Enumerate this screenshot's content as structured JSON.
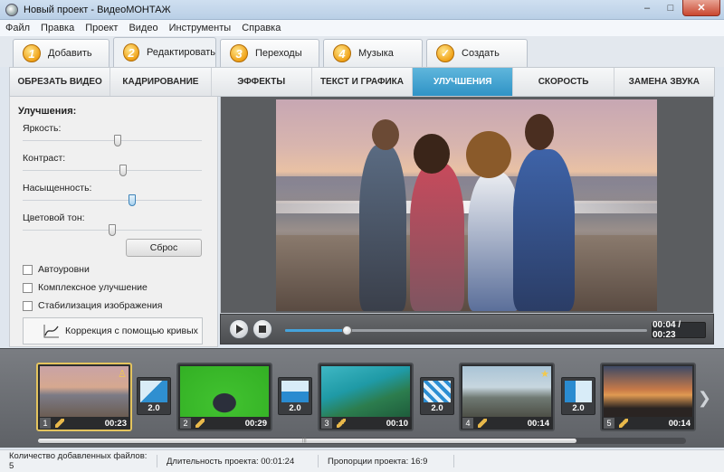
{
  "window": {
    "title": "Новый проект - ВидеоМОНТАЖ",
    "close_label": "✕",
    "min_label": "–",
    "max_label": "□"
  },
  "menu": [
    "Файл",
    "Правка",
    "Проект",
    "Видео",
    "Инструменты",
    "Справка"
  ],
  "steps": [
    {
      "num": "1",
      "label": "Добавить"
    },
    {
      "num": "2",
      "label": "Редактировать"
    },
    {
      "num": "3",
      "label": "Переходы"
    },
    {
      "num": "4",
      "label": "Музыка"
    },
    {
      "num": "✓",
      "label": "Создать"
    }
  ],
  "active_step": 1,
  "subtabs": [
    "ОБРЕЗАТЬ ВИДЕО",
    "КАДРИРОВАНИЕ",
    "ЭФФЕКТЫ",
    "ТЕКСТ И ГРАФИКА",
    "УЛУЧШЕНИЯ",
    "СКОРОСТЬ",
    "ЗАМЕНА ЗВУКА"
  ],
  "active_subtab": 4,
  "enhance": {
    "title": "Улучшения:",
    "sliders": [
      {
        "label": "Яркость:",
        "value": 0.53
      },
      {
        "label": "Контраст:",
        "value": 0.56
      },
      {
        "label": "Насыщенность:",
        "value": 0.61
      },
      {
        "label": "Цветовой тон:",
        "value": 0.5
      }
    ],
    "reset_label": "Сброс",
    "checkboxes": [
      {
        "label": "Автоуровни",
        "checked": false
      },
      {
        "label": "Комплексное улучшение",
        "checked": false
      },
      {
        "label": "Стабилизация изображения",
        "checked": false
      }
    ],
    "curves_label": "Коррекция с помощью кривых"
  },
  "player": {
    "timecode": "00:04 / 00:23",
    "progress": 0.17
  },
  "timeline": {
    "clips": [
      {
        "num": "1",
        "duration": "00:23",
        "badge": "person"
      },
      {
        "num": "2",
        "duration": "00:29",
        "badge": ""
      },
      {
        "num": "3",
        "duration": "00:10",
        "badge": ""
      },
      {
        "num": "4",
        "duration": "00:14",
        "badge": "star"
      },
      {
        "num": "5",
        "duration": "00:14",
        "badge": ""
      }
    ],
    "transitions": [
      "2.0",
      "2.0",
      "2.0",
      "2.0"
    ],
    "next_arrow": "❯"
  },
  "status": {
    "files": "Количество добавленных файлов: 5",
    "duration": "Длительность проекта: 00:01:24",
    "aspect": "Пропорции проекта: 16:9"
  },
  "colors": {
    "accent": "#2f93c6",
    "step_orange": "#f0a218",
    "selected_clip": "#e4c45e"
  }
}
